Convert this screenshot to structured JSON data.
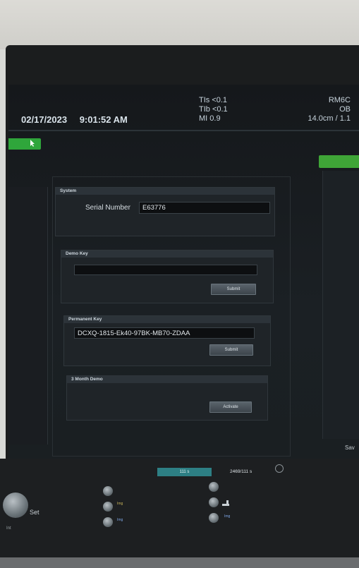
{
  "header": {
    "date": "02/17/2023",
    "time": "9:01:52 AM",
    "tis": "TIs <0.1",
    "tib": "TIb <0.1",
    "mi": "MI 0.9",
    "probe": "RM6C",
    "preset": "OB",
    "depth": "14.0cm / 1.1"
  },
  "system": {
    "title": "System",
    "serial_label": "Serial Number",
    "serial_value": "E63776"
  },
  "demo_key": {
    "title": "Demo Key",
    "value": "",
    "submit_label": "Submit"
  },
  "permanent_key": {
    "title": "Permanent Key",
    "value": "DCXQ-1815-Ek40-97BK-MB70-ZDAA",
    "submit_label": "Submit"
  },
  "three_month_demo": {
    "title": "3 Month Demo",
    "activate_label": "Activate"
  },
  "bottom": {
    "progress_label": "111 s",
    "counter": "2469/111 s",
    "set_label": "Set",
    "save_label": "Sav",
    "img_label_1": "Img",
    "img_label_2": "Img",
    "img_label_3": "Img",
    "int_label": "Int"
  },
  "colors": {
    "accent_green": "#2fa63b",
    "progress_teal": "#2d7f84"
  }
}
